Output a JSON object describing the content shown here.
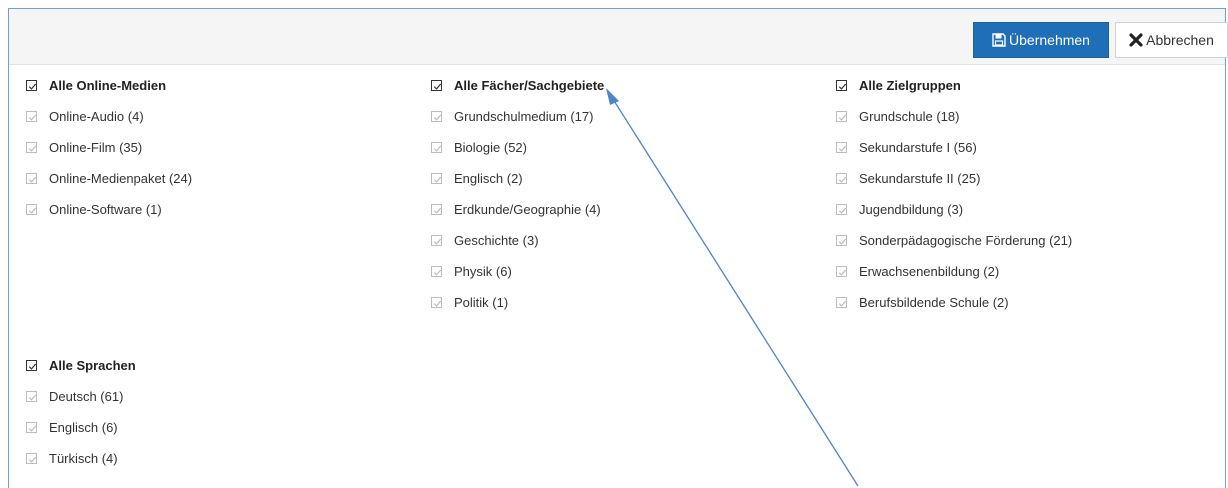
{
  "toolbar": {
    "apply_label": "Übernehmen",
    "cancel_label": "Abbrechen"
  },
  "groups": {
    "media": {
      "header": "Alle Online-Medien",
      "items": [
        "Online-Audio (4)",
        "Online-Film (35)",
        "Online-Medienpaket (24)",
        "Online-Software (1)"
      ]
    },
    "subjects": {
      "header": "Alle Fächer/Sachgebiete",
      "items": [
        "Grundschulmedium (17)",
        "Biologie (52)",
        "Englisch (2)",
        "Erdkunde/Geographie (4)",
        "Geschichte (3)",
        "Physik (6)",
        "Politik (1)"
      ]
    },
    "audiences": {
      "header": "Alle Zielgruppen",
      "items": [
        "Grundschule (18)",
        "Sekundarstufe I (56)",
        "Sekundarstufe II (25)",
        "Jugendbildung (3)",
        "Sonderpädagogische Förderung (21)",
        "Erwachsenenbildung (2)",
        "Berufsbildende Schule (2)"
      ]
    },
    "languages": {
      "header": "Alle Sprachen",
      "items": [
        "Deutsch (61)",
        "Englisch (6)",
        "Türkisch (4)"
      ]
    }
  },
  "icons": {
    "apply": "save-icon",
    "cancel": "x-icon",
    "checkbox": "check-icon"
  },
  "colors": {
    "accent": "#1f6eb8",
    "annotation": "#4a86c8"
  }
}
